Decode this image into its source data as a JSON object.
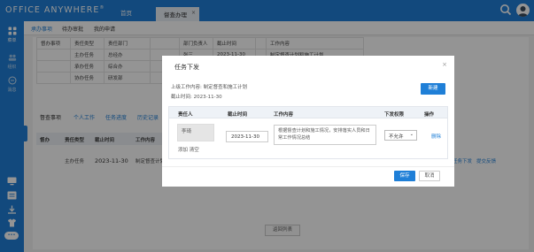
{
  "topbar": {
    "brand": "Office Anywhere",
    "brand_mark": "®",
    "tab_home": "首页",
    "tab_active": "督查办理",
    "tab_close": "×"
  },
  "sidebar": {
    "menu": "菜单",
    "org": "组织",
    "msg": "消息",
    "toggle": "•••"
  },
  "subnav": {
    "items": [
      "承办事项",
      "待办审批",
      "我的申请"
    ]
  },
  "background": {
    "top_rows": [
      [
        "督办事项",
        "责任类型",
        "责任部门",
        "",
        "部门负责人",
        "截止时间",
        "",
        "工作内容"
      ],
      [
        "",
        "主办任务",
        "总经办",
        "",
        "张三",
        "2023-11-30",
        "",
        "制定督查计划和施工计划"
      ],
      [
        "",
        "承办任务",
        "综合办",
        "",
        "",
        "",
        "",
        ""
      ],
      [
        "",
        "协办任务",
        "研发部",
        "",
        "",
        "",
        "",
        ""
      ]
    ],
    "tabs": [
      "督查事项",
      "个人工作",
      "任务进度",
      "历史记录"
    ],
    "lower_headers": [
      "督办",
      "责任类型",
      "截止时间",
      "工作内容"
    ],
    "lower_row": [
      "主办任务",
      "2023-11-30",
      "制定督查计划和施工计划"
    ],
    "right_actions": [
      "任务下发",
      "提交反馈"
    ],
    "return_button": "返回列表"
  },
  "modal": {
    "title": "任务下发",
    "close": "×",
    "upper_content_label": "上级工作内容:",
    "upper_content_value": "制定督查和施工计划",
    "deadline_label": "截止时间:",
    "deadline_value": "2023-11-30",
    "new_button": "新建",
    "columns": [
      "责任人",
      "截止时间",
      "工作内容",
      "下发权限",
      "操作"
    ],
    "row": {
      "assignee": "李琦",
      "add_link": "添加",
      "clear_link": "清空",
      "deadline": "2023-11-30",
      "content": "根据督查计划和施工情况，安排落实人员和日常工作情况总结",
      "permission": "不允许",
      "action": "删除"
    },
    "save_button": "保存",
    "cancel_button": "取消"
  },
  "colors": {
    "primary": "#1f7fd7",
    "overlay": "rgba(0,0,0,0.42)"
  }
}
